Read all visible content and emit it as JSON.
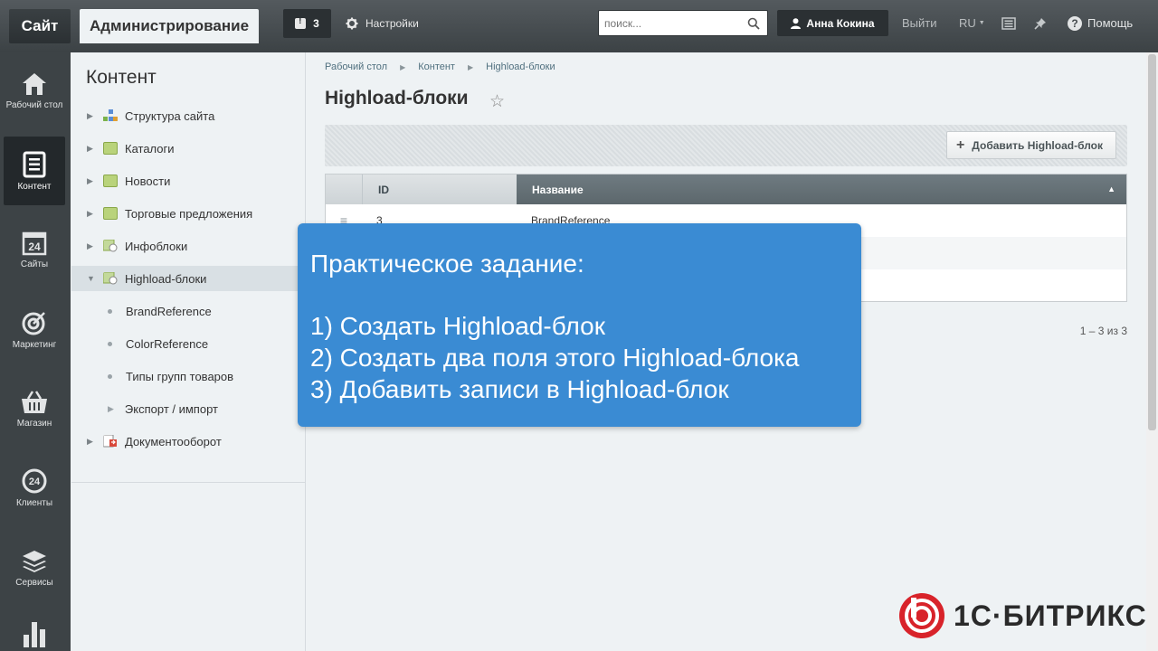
{
  "topbar": {
    "site_label": "Сайт",
    "admin_label": "Администрирование",
    "notifications_count": "3",
    "settings_label": "Настройки",
    "search_placeholder": "поиск...",
    "user_name": "Анна Кокина",
    "logout_label": "Выйти",
    "lang_label": "RU",
    "help_label": "Помощь"
  },
  "leftnav": {
    "items": [
      {
        "label": "Рабочий стол",
        "icon": "home-icon"
      },
      {
        "label": "Контент",
        "icon": "document-icon"
      },
      {
        "label": "Сайты",
        "icon": "calendar-24-icon"
      },
      {
        "label": "Маркетинг",
        "icon": "target-icon"
      },
      {
        "label": "Магазин",
        "icon": "basket-icon"
      },
      {
        "label": "Клиенты",
        "icon": "clients-24-icon"
      },
      {
        "label": "Сервисы",
        "icon": "layers-icon"
      }
    ]
  },
  "tree": {
    "title": "Контент",
    "items": [
      {
        "label": "Структура сайта"
      },
      {
        "label": "Каталоги"
      },
      {
        "label": "Новости"
      },
      {
        "label": "Торговые предложения"
      },
      {
        "label": "Инфоблоки"
      },
      {
        "label": "Highload-блоки"
      },
      {
        "label": "BrandReference"
      },
      {
        "label": "ColorReference"
      },
      {
        "label": "Типы групп товаров"
      },
      {
        "label": "Экспорт / импорт"
      },
      {
        "label": "Документооборот"
      }
    ]
  },
  "breadcrumbs": [
    "Рабочий стол",
    "Контент",
    "Highload-блоки"
  ],
  "page": {
    "title": "Highload-блоки",
    "add_button": "Добавить Highload-блок"
  },
  "grid": {
    "columns": [
      "ID",
      "Название"
    ],
    "rows": [
      {
        "id": "3",
        "name": "BrandReference"
      }
    ],
    "pager": "1 – 3 из 3"
  },
  "overlay": {
    "heading": "Практическое задание:",
    "items": [
      "1) Создать Highload-блок",
      "2) Создать два поля этого Highload-блока",
      "3) Добавить записи в Highload-блок"
    ]
  },
  "logo": {
    "text": "1С·БИТРИКС"
  },
  "colors": {
    "topbar": "#454b4e",
    "leftnav": "#3d4346",
    "accent_overlay": "#3a8bd3",
    "logo_red": "#d8232a"
  }
}
